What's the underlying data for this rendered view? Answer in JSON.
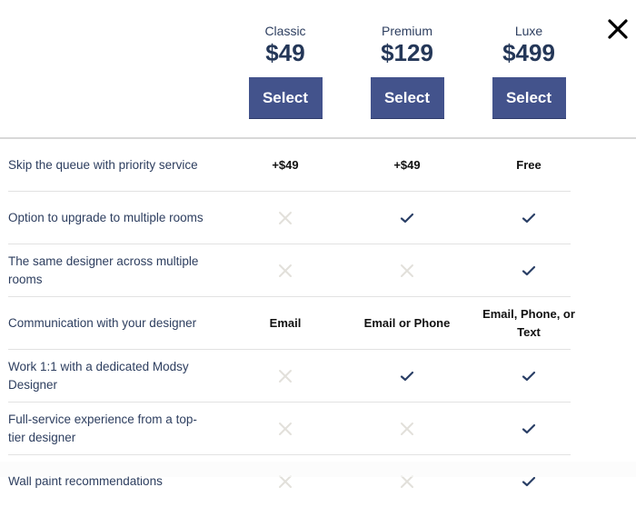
{
  "plans": [
    {
      "name": "Classic",
      "price": "$49",
      "button_label": "Select"
    },
    {
      "name": "Premium",
      "price": "$129",
      "button_label": "Select"
    },
    {
      "name": "Luxe",
      "price": "$499",
      "button_label": "Select"
    }
  ],
  "close_icon": "close-icon",
  "colors": {
    "accent": "#43538c",
    "price_text": "#243758",
    "check": "#2a3f66",
    "cross": "#e2e0da",
    "feature_text": "#2d3e5f"
  },
  "features": [
    {
      "label": "Skip the queue with priority service",
      "values": [
        {
          "type": "text",
          "text": "+$49"
        },
        {
          "type": "text",
          "text": "+$49"
        },
        {
          "type": "text",
          "text": "Free"
        }
      ]
    },
    {
      "label": "Option to upgrade to multiple rooms",
      "values": [
        {
          "type": "cross"
        },
        {
          "type": "check"
        },
        {
          "type": "check"
        }
      ]
    },
    {
      "label": "The same designer across multiple rooms",
      "values": [
        {
          "type": "cross"
        },
        {
          "type": "cross"
        },
        {
          "type": "check"
        }
      ]
    },
    {
      "label": "Communication with your designer",
      "values": [
        {
          "type": "text",
          "text": "Email"
        },
        {
          "type": "text",
          "text": "Email or Phone"
        },
        {
          "type": "text",
          "text": "Email, Phone, or Text"
        }
      ]
    },
    {
      "label": "Work 1:1 with a dedicated Modsy Designer",
      "values": [
        {
          "type": "cross"
        },
        {
          "type": "check"
        },
        {
          "type": "check"
        }
      ]
    },
    {
      "label": "Full-service experience from a top-tier designer",
      "values": [
        {
          "type": "cross"
        },
        {
          "type": "cross"
        },
        {
          "type": "check"
        }
      ]
    },
    {
      "label": "Wall paint recommendations",
      "values": [
        {
          "type": "cross"
        },
        {
          "type": "cross"
        },
        {
          "type": "check"
        }
      ]
    }
  ]
}
